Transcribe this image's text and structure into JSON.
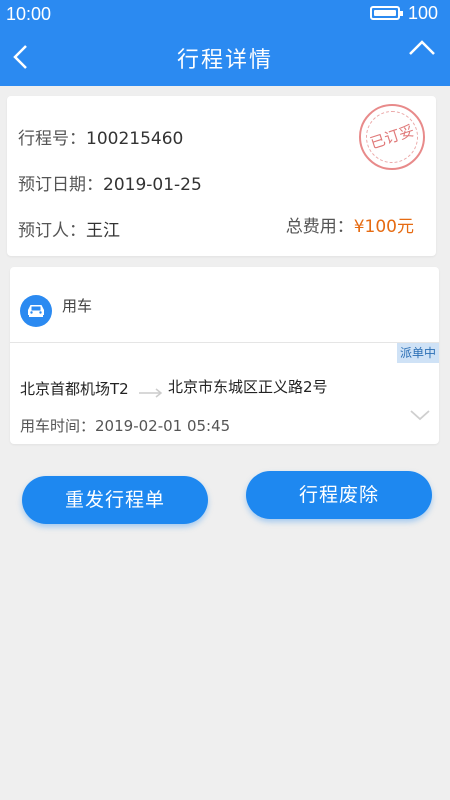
{
  "status_bar": {
    "time": "10:00",
    "battery": "100"
  },
  "header": {
    "title": "行程详情"
  },
  "trip_info": {
    "trip_no_label": "行程号：",
    "trip_no": "100215460",
    "booking_date_label": "预订日期：",
    "booking_date": "2019-01-25",
    "booker_label": "预订人：",
    "booker": "王江",
    "total_fee_label": "总费用：",
    "total_fee": "¥100元",
    "stamp_text": "已订妥"
  },
  "car_section": {
    "title": "用车",
    "status_badge": "派单中",
    "from": "北京首都机场T2",
    "to": "北京市东城区正义路2号",
    "use_time_label": "用车时间：",
    "use_time": "2019-02-01  05:45"
  },
  "actions": {
    "reissue": "重发行程单",
    "cancel": "行程废除"
  },
  "icons": {
    "back": "back-arrow-icon",
    "collapse": "chevron-up-icon",
    "expand": "chevron-down-icon",
    "car": "car-icon",
    "arrow": "route-arrow-icon",
    "battery": "battery-icon"
  },
  "colors": {
    "primary": "#2b8af1",
    "fee": "#e66b12",
    "stamp": "#e07a7a"
  }
}
